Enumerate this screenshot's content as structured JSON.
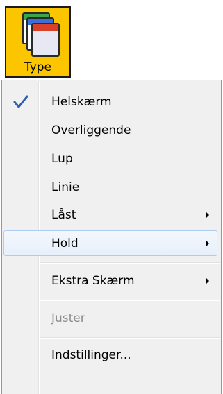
{
  "toolbar": {
    "type_label": "Type",
    "type_icon": "windows-stack-icon"
  },
  "menu": {
    "items": [
      {
        "label": "Helskærm",
        "checked": true
      },
      {
        "label": "Overliggende"
      },
      {
        "label": "Lup"
      },
      {
        "label": "Linie"
      },
      {
        "label": "Låst",
        "submenu": true
      },
      {
        "label": "Hold",
        "submenu": true,
        "highlighted": true
      },
      {
        "label": "Ekstra Skærm",
        "submenu": true
      },
      {
        "label": "Juster",
        "disabled": true
      },
      {
        "label": "Indstillinger..."
      }
    ],
    "colors": {
      "highlight_border": "#aeccf1",
      "check": "#2b5fb4",
      "toolbar_bg": "#fbc600"
    }
  }
}
